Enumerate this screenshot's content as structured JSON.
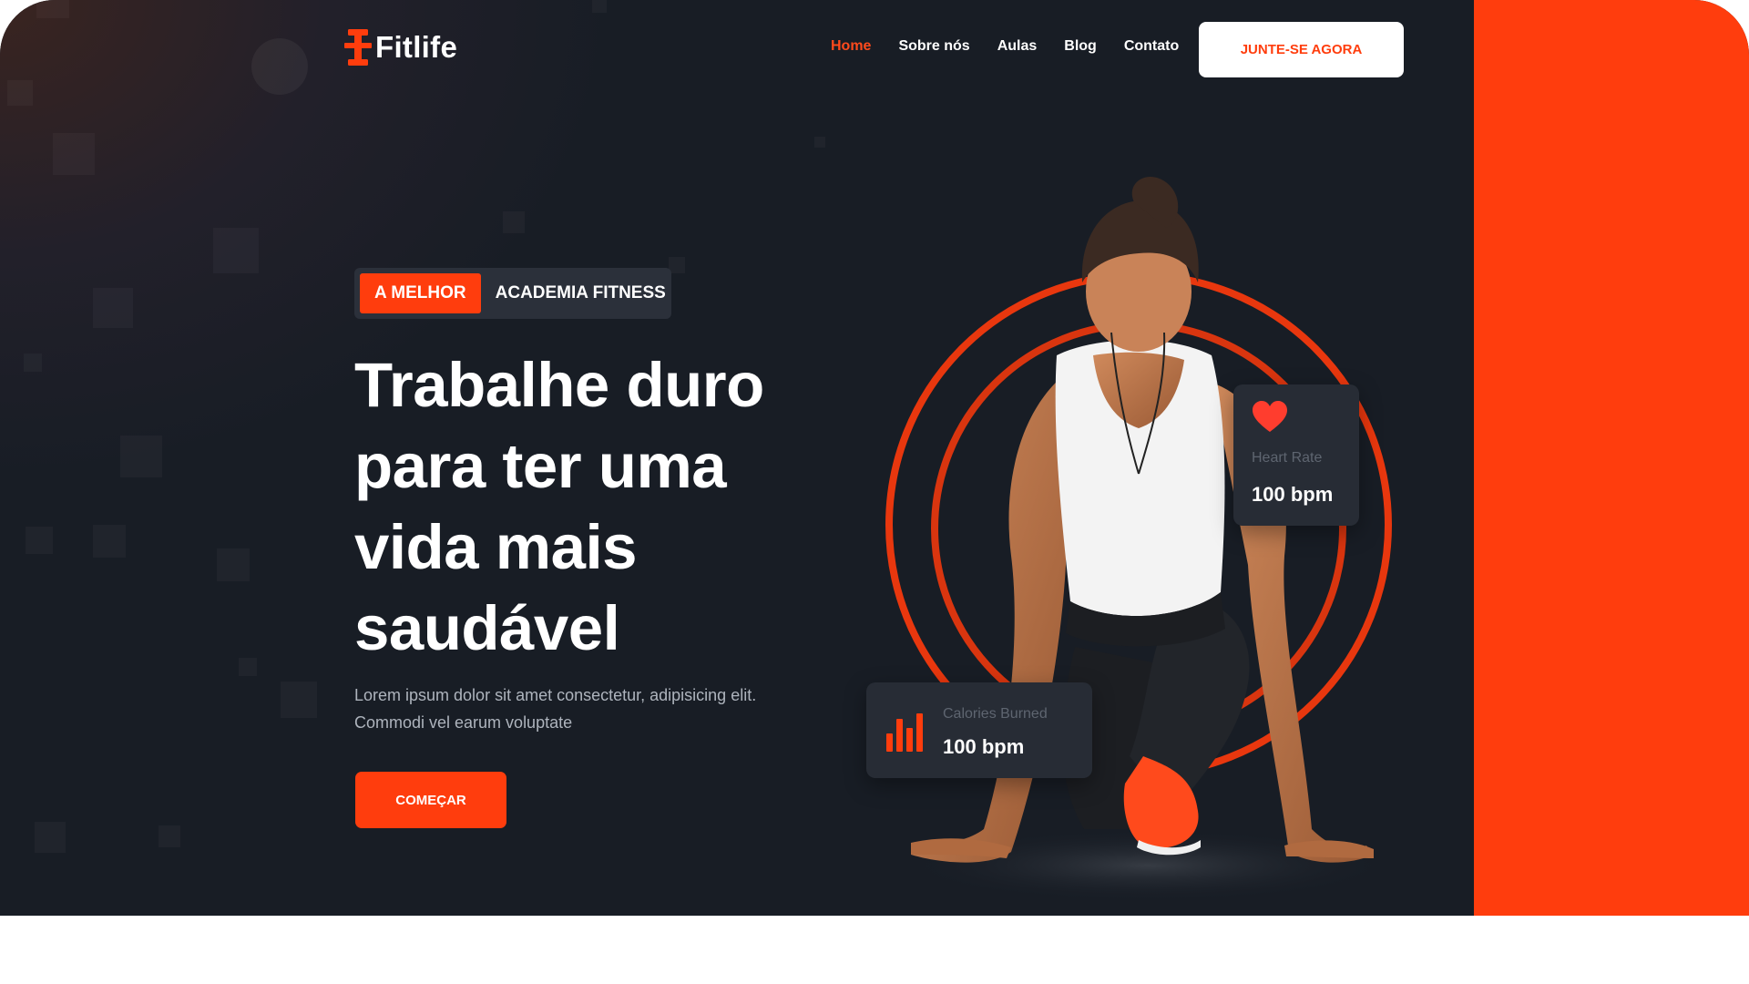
{
  "brand": {
    "name": "Fitlife",
    "accent": "#ff3d0d",
    "background": "#181d25"
  },
  "nav": {
    "items": [
      {
        "label": "Home",
        "active": true
      },
      {
        "label": "Sobre nós",
        "active": false
      },
      {
        "label": "Aulas",
        "active": false
      },
      {
        "label": "Blog",
        "active": false
      },
      {
        "label": "Contato",
        "active": false
      }
    ],
    "join_label": "JUNTE-SE AGORA"
  },
  "hero": {
    "tag_accent": "A MELHOR",
    "tag_rest": "ACADEMIA FITNESS",
    "headline": "Trabalhe duro para ter uma vida mais saudável",
    "description": "Lorem ipsum dolor sit amet consectetur, adipisicing elit. Commodi vel earum voluptate",
    "cta_label": "COMEÇAR"
  },
  "stats": {
    "heart": {
      "label": "Heart Rate",
      "value": "100 bpm",
      "icon": "heart-icon"
    },
    "calories": {
      "label": "Calories Burned",
      "value": "100 bpm",
      "icon": "bar-chart-icon"
    }
  }
}
